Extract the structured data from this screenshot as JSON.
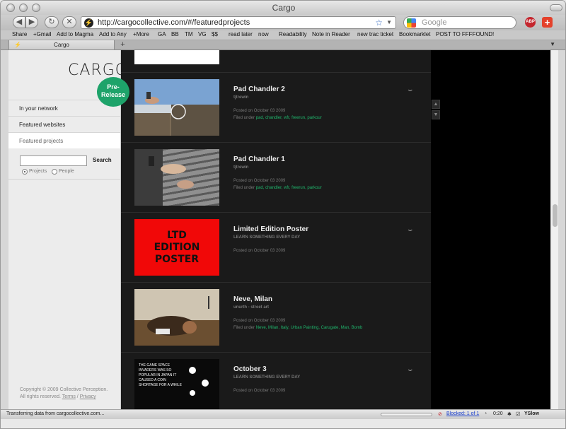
{
  "window": {
    "title": "Cargo"
  },
  "navbar": {
    "url": "http://cargocollective.com/#/featuredprojects",
    "search_placeholder": "Google",
    "abp_label": "ABP"
  },
  "bookmarks": [
    "Share",
    "+Gmail",
    "Add to Magma",
    "Add to Any",
    "+More",
    "GA",
    "BB",
    "TM",
    "VG",
    "$$",
    "read later",
    "now",
    "Readability",
    "Note in Reader",
    "new trac ticket",
    "Bookmarklet",
    "POST TO FFFFOUND!"
  ],
  "tab": {
    "label": "Cargo"
  },
  "sidebar": {
    "logo": "CARGO",
    "badge": "Pre-Release",
    "nav": [
      {
        "label": "In your network"
      },
      {
        "label": "Featured websites"
      },
      {
        "label": "Featured projects"
      }
    ],
    "search_button": "Search",
    "radio_projects": "Projects",
    "radio_people": "People",
    "copyright": "Copyright © 2009 Collective Perception.",
    "rights": "All rights reserved.",
    "terms": "Terms",
    "privacy": "Privacy"
  },
  "feed": [
    {
      "title": "Pad Chandler 2",
      "author": "tjtrewin",
      "posted": "Posted on October 03 2009",
      "filed_label": "Filed under",
      "tags": "pad, chandler, wfr, freerun, parkour"
    },
    {
      "title": "Pad Chandler 1",
      "author": "tjtrewin",
      "posted": "Posted on October 03 2009",
      "filed_label": "Filed under",
      "tags": "pad, chandler, wfr, freerun, parkour"
    },
    {
      "title": "Limited Edition Poster",
      "author": "LEARN SOMETHING EVERY DAY",
      "posted": "Posted on October 03 2009",
      "poster_text": "LTD EDITION POSTER"
    },
    {
      "title": "Neve, Milan",
      "author": "unurth - street art",
      "posted": "Posted on October 03 2009",
      "filed_label": "Filed under",
      "tags": "Neve, Milan, Italy, Urban Painting, Carugate, Man, Bomb"
    },
    {
      "title": "October 3",
      "author": "LEARN SOMETHING EVERY DAY",
      "posted": "Posted on October 03 2009",
      "thumb_text": "THE GAME SPACE INVADERS WAS SO POPULAR IN JAPAN IT CAUSED A COIN SHORTAGE FOR A WHILE"
    }
  ],
  "status": {
    "message": "Transferring data from cargocollective.com...",
    "blocked": "Blocked: 1 of 1",
    "time": "0:20",
    "yslow": "YSlow"
  }
}
